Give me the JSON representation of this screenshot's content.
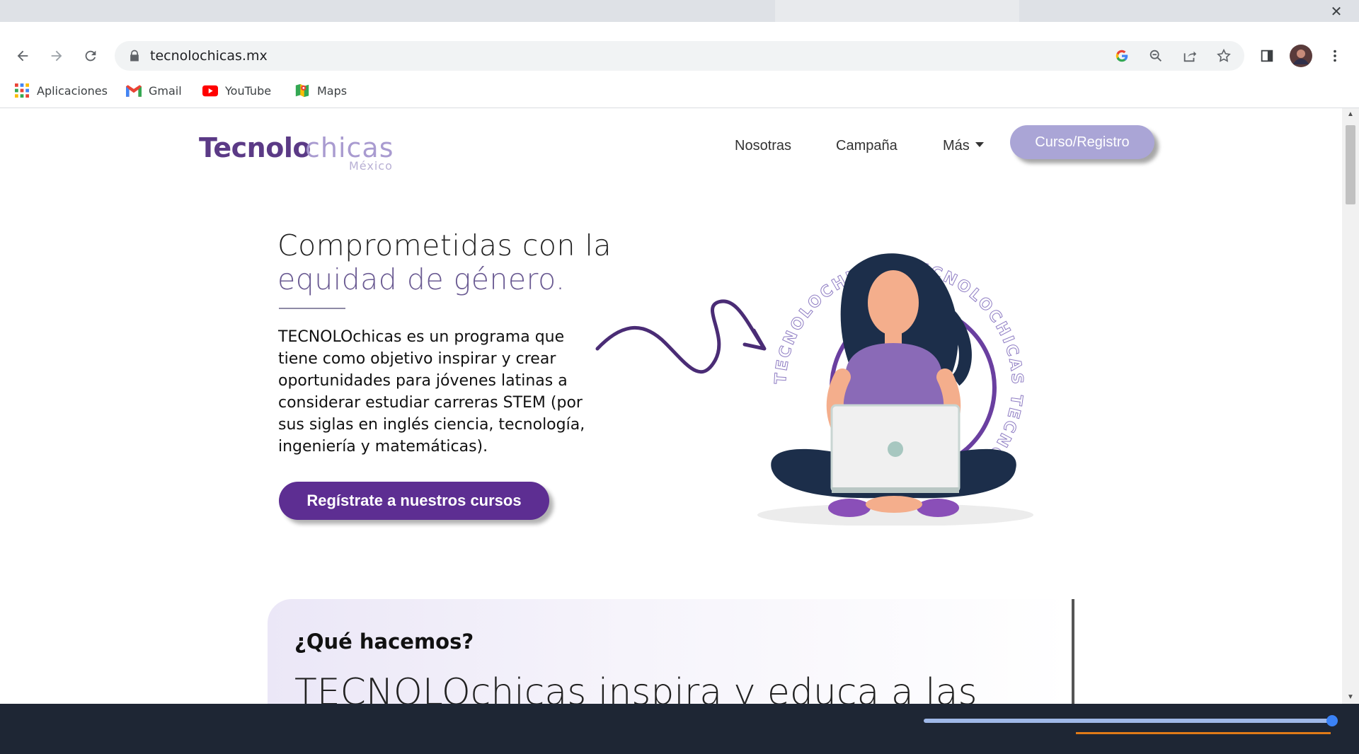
{
  "browser": {
    "url": "tecnolochicas.mx",
    "bookmarks": [
      {
        "label": "Aplicaciones",
        "icon": "apps-grid-icon"
      },
      {
        "label": "Gmail",
        "icon": "gmail-icon"
      },
      {
        "label": "YouTube",
        "icon": "youtube-icon"
      },
      {
        "label": "Maps",
        "icon": "maps-icon"
      }
    ],
    "toolbar_icons": [
      "back-icon",
      "forward-icon",
      "reload-icon",
      "lock-icon",
      "google-icon",
      "zoom-icon",
      "share-icon",
      "star-icon",
      "side-panel-icon",
      "profile-avatar",
      "menu-kebab-icon"
    ]
  },
  "site": {
    "logo": {
      "bold": "Tecnolo",
      "light": "chicas",
      "sub": "México"
    },
    "nav": {
      "nosotras": "Nosotras",
      "campana": "Campaña",
      "mas": "Más",
      "registro": "Curso/Registro"
    },
    "hero": {
      "title_line1": "Comprometidas con la",
      "title_line2": "equidad de género.",
      "text": "TECNOLOchicas es un programa que tiene como objetivo inspirar y crear oportunidades para jóvenes latinas a considerar estudiar carreras STEM (por sus siglas en inglés ciencia, tecnología, ingeniería y matemáticas).",
      "cta": "Regístrate a nuestros cursos",
      "badge_text": "TECNOLOCHICAS TECNOLOCHICAS TECNOLOCHICAS"
    },
    "section": {
      "title": "¿Qué hacemos?",
      "big_text": "TECNOLOchicas inspira y educa a las"
    }
  },
  "colors": {
    "brand_purple": "#5d2e92",
    "brand_lavender": "#aaa5d6",
    "logo_dark": "#5b3a86",
    "logo_light": "#a99bd0"
  }
}
